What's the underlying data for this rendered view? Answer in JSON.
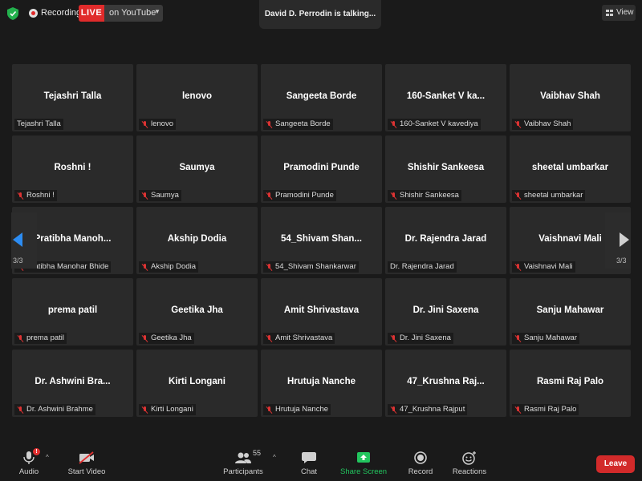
{
  "topbar": {
    "recording_label": "Recording",
    "live_label": "LIVE",
    "live_target": "on YouTube",
    "talking": "David D. Perrodin is talking...",
    "view_label": "View"
  },
  "pagination": {
    "left_page": "3/3",
    "right_page": "3/3"
  },
  "tiles": [
    {
      "name": "Tejashri Talla",
      "label": "Tejashri Talla",
      "muted": false
    },
    {
      "name": "lenovo",
      "label": "lenovo",
      "muted": true
    },
    {
      "name": "Sangeeta Borde",
      "label": "Sangeeta Borde",
      "muted": true
    },
    {
      "name": "160-Sanket  V  ka...",
      "label": "160-Sanket V kavediya",
      "muted": true
    },
    {
      "name": "Vaibhav Shah",
      "label": "Vaibhav Shah",
      "muted": true
    },
    {
      "name": "Roshni !",
      "label": "Roshni !",
      "muted": true
    },
    {
      "name": "Saumya",
      "label": "Saumya",
      "muted": true
    },
    {
      "name": "Pramodini Punde",
      "label": "Pramodini Punde",
      "muted": true
    },
    {
      "name": "Shishir Sankeesa",
      "label": "Shishir Sankeesa",
      "muted": true
    },
    {
      "name": "sheetal umbarkar",
      "label": "sheetal umbarkar",
      "muted": true
    },
    {
      "name": "Pratibha  Manoh...",
      "label": "Pratibha Manohar Bhide",
      "muted": true
    },
    {
      "name": "Akship Dodia",
      "label": "Akship Dodia",
      "muted": true
    },
    {
      "name": "54_Shivam  Shan...",
      "label": "54_Shivam Shankarwar",
      "muted": true
    },
    {
      "name": "Dr. Rajendra Jarad",
      "label": "Dr. Rajendra Jarad",
      "muted": false
    },
    {
      "name": "Vaishnavi Mali",
      "label": "Vaishnavi Mali",
      "muted": true
    },
    {
      "name": "prema patil",
      "label": "prema patil",
      "muted": true
    },
    {
      "name": "Geetika Jha",
      "label": "Geetika Jha",
      "muted": true
    },
    {
      "name": "Amit Shrivastava",
      "label": "Amit Shrivastava",
      "muted": true
    },
    {
      "name": "Dr. Jini Saxena",
      "label": "Dr. Jini Saxena",
      "muted": true
    },
    {
      "name": "Sanju Mahawar",
      "label": "Sanju Mahawar",
      "muted": true
    },
    {
      "name": "Dr. Ashwini Bra...",
      "label": "Dr. Ashwini Brahme",
      "muted": true
    },
    {
      "name": "Kirti Longani",
      "label": "Kirti Longani",
      "muted": true
    },
    {
      "name": "Hrutuja Nanche",
      "label": "Hrutuja Nanche",
      "muted": true
    },
    {
      "name": "47_Krushna  Raj...",
      "label": "47_Krushna Rajput",
      "muted": true
    },
    {
      "name": "Rasmi Raj Palo",
      "label": "Rasmi Raj Palo",
      "muted": true
    }
  ],
  "toolbar": {
    "audio": "Audio",
    "start_video": "Start Video",
    "participants": "Participants",
    "participant_count": "55",
    "chat": "Chat",
    "share_screen": "Share Screen",
    "record": "Record",
    "reactions": "Reactions",
    "leave": "Leave"
  },
  "colors": {
    "share_screen": "#22c55e",
    "live": "#e02b2b",
    "leave": "#d22a2a",
    "muted_mic": "#dd3333",
    "nav_arrow_active": "#2c8cf2"
  }
}
